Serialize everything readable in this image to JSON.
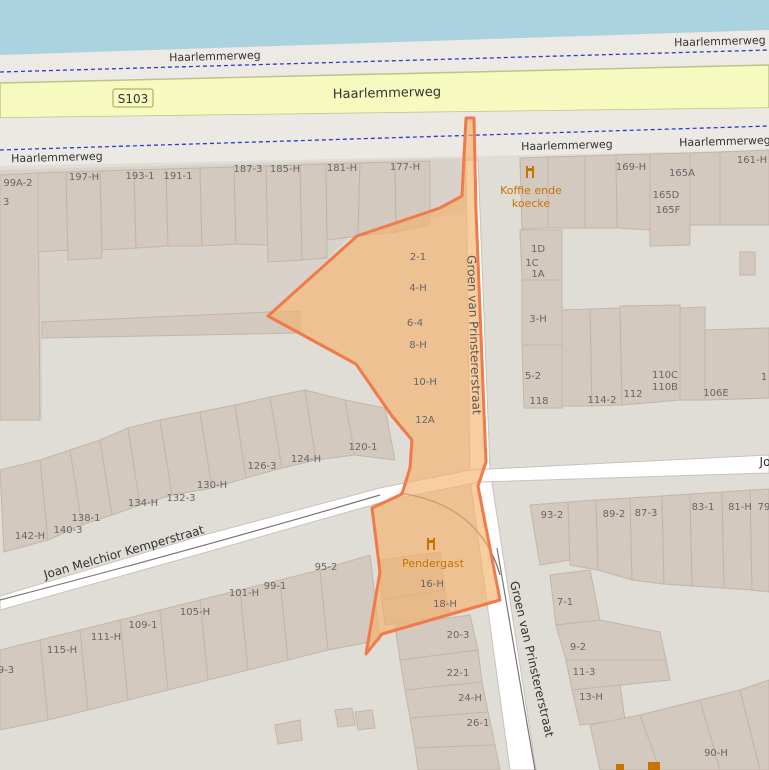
{
  "roads": {
    "haarlemmerweg_main": "Haarlemmerweg",
    "haarlemmerweg_north_path": "Haarlemmerweg",
    "haarlemmerweg_north_path_right": "Haarlemmerweg",
    "haarlemmerweg_south_path_left": "Haarlemmerweg",
    "haarlemmerweg_south_path_mid": "Haarlemmerweg",
    "haarlemmerweg_south_path_right": "Haarlemmerweg",
    "route_shield": "S103",
    "groen_north": "Groen van Prinstererstraat",
    "groen_south": "Groen van Prinstererstraat",
    "joan_melchior": "Joan Melchior Kemperstraat",
    "joan_right_fragment": "Jo"
  },
  "pois": {
    "koffie": "Koffie ende koecke",
    "koffie_line1": "Koffie ende",
    "koffie_line2": "koecke",
    "pendergast": "Pendergast"
  },
  "house_numbers": [
    "99A-2",
    "197-H",
    "193-1",
    "191-1",
    "187-3",
    "185-H",
    "181-H",
    "177-H",
    "2-1",
    "4-H",
    "6-4",
    "8-H",
    "10-H",
    "12A",
    "169-H",
    "165A",
    "165D",
    "165F",
    "161-H",
    "1D",
    "1C",
    "1A",
    "3-H",
    "5-2",
    "118",
    "114-2",
    "112",
    "110C",
    "110B",
    "106E",
    "120-1",
    "124-H",
    "126-3",
    "130-H",
    "132-3",
    "134-H",
    "138-1",
    "140-3",
    "142-H",
    "95-2",
    "101-H",
    "99-1",
    "105-H",
    "109-1",
    "111-H",
    "115-H",
    "9-3",
    "16-H",
    "18-H",
    "20-3",
    "22-1",
    "24-H",
    "26-1",
    "93-2",
    "89-2",
    "87-3",
    "83-1",
    "81-H",
    "7-1",
    "9-2",
    "11-3",
    "13-H",
    "90-H",
    "3",
    "1",
    "79"
  ],
  "colors": {
    "water": "#aad3df",
    "land": "#e0dcd6",
    "building": "#d4c9bf",
    "building_stroke": "#c3b5aa",
    "primary_road": "#f7fabf",
    "primary_road_casing": "#bcc487",
    "minor_road": "#ffffff",
    "highlight_fill": "#f5b26b",
    "highlight_stroke": "#f07a4a",
    "poi_orange": "#c77400",
    "label_text": "#555555",
    "path_dashed": "#2b3ccc"
  }
}
